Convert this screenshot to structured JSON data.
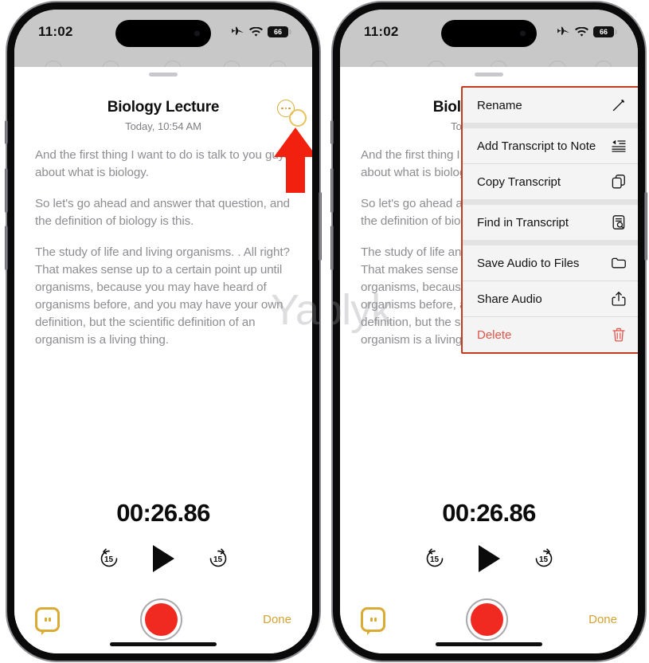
{
  "status_bar": {
    "time": "11:02",
    "icons": [
      "airplane-mode-icon",
      "wifi-icon",
      "battery-icon"
    ],
    "battery_level": "66"
  },
  "memo": {
    "title": "Biology Lecture",
    "date": "Today, 10:54 AM",
    "more_button_label": "More options",
    "transcript_paragraphs": [
      "And the first thing I want to do is talk to you guys about what is biology.",
      "So let's go ahead and answer that question, and the definition of biology is this.",
      "The study of life and living organisms. . All right? That makes sense up to a certain point up until organisms, because you may have heard of organisms before, and you may have your own definition, but the scientific definition of an organism is a living thing."
    ],
    "timer": "00:26.86",
    "skip_back_label": "15",
    "skip_forward_label": "15",
    "play_label": "Play",
    "transcript_toggle_label": "Transcript",
    "record_label": "Record",
    "done_label": "Done"
  },
  "context_menu": {
    "items": [
      {
        "label": "Rename",
        "icon": "pencil-icon",
        "danger": false,
        "separator_after": "thick"
      },
      {
        "label": "Add Transcript to Note",
        "icon": "add-to-note-icon",
        "danger": false,
        "separator_after": "thin"
      },
      {
        "label": "Copy Transcript",
        "icon": "copy-icon",
        "danger": false,
        "separator_after": "thick"
      },
      {
        "label": "Find in Transcript",
        "icon": "find-document-icon",
        "danger": false,
        "separator_after": "thick"
      },
      {
        "label": "Save Audio to Files",
        "icon": "folder-icon",
        "danger": false,
        "separator_after": "thin"
      },
      {
        "label": "Share Audio",
        "icon": "share-icon",
        "danger": false,
        "separator_after": "thin"
      },
      {
        "label": "Delete",
        "icon": "trash-icon",
        "danger": true,
        "separator_after": "none"
      }
    ]
  },
  "annotation": {
    "arrow_color": "#f2200e",
    "highlight_color": "#e8c25a",
    "menu_outline_color": "#c43a1e"
  },
  "watermark": {
    "text": "Yablyk"
  },
  "colors": {
    "accent_gold": "#d2a334",
    "record_red": "#f02a21",
    "delete_red": "#e2544a",
    "transcript_gray": "#8d8d92",
    "status_bar_bg": "#c8c8c8"
  }
}
